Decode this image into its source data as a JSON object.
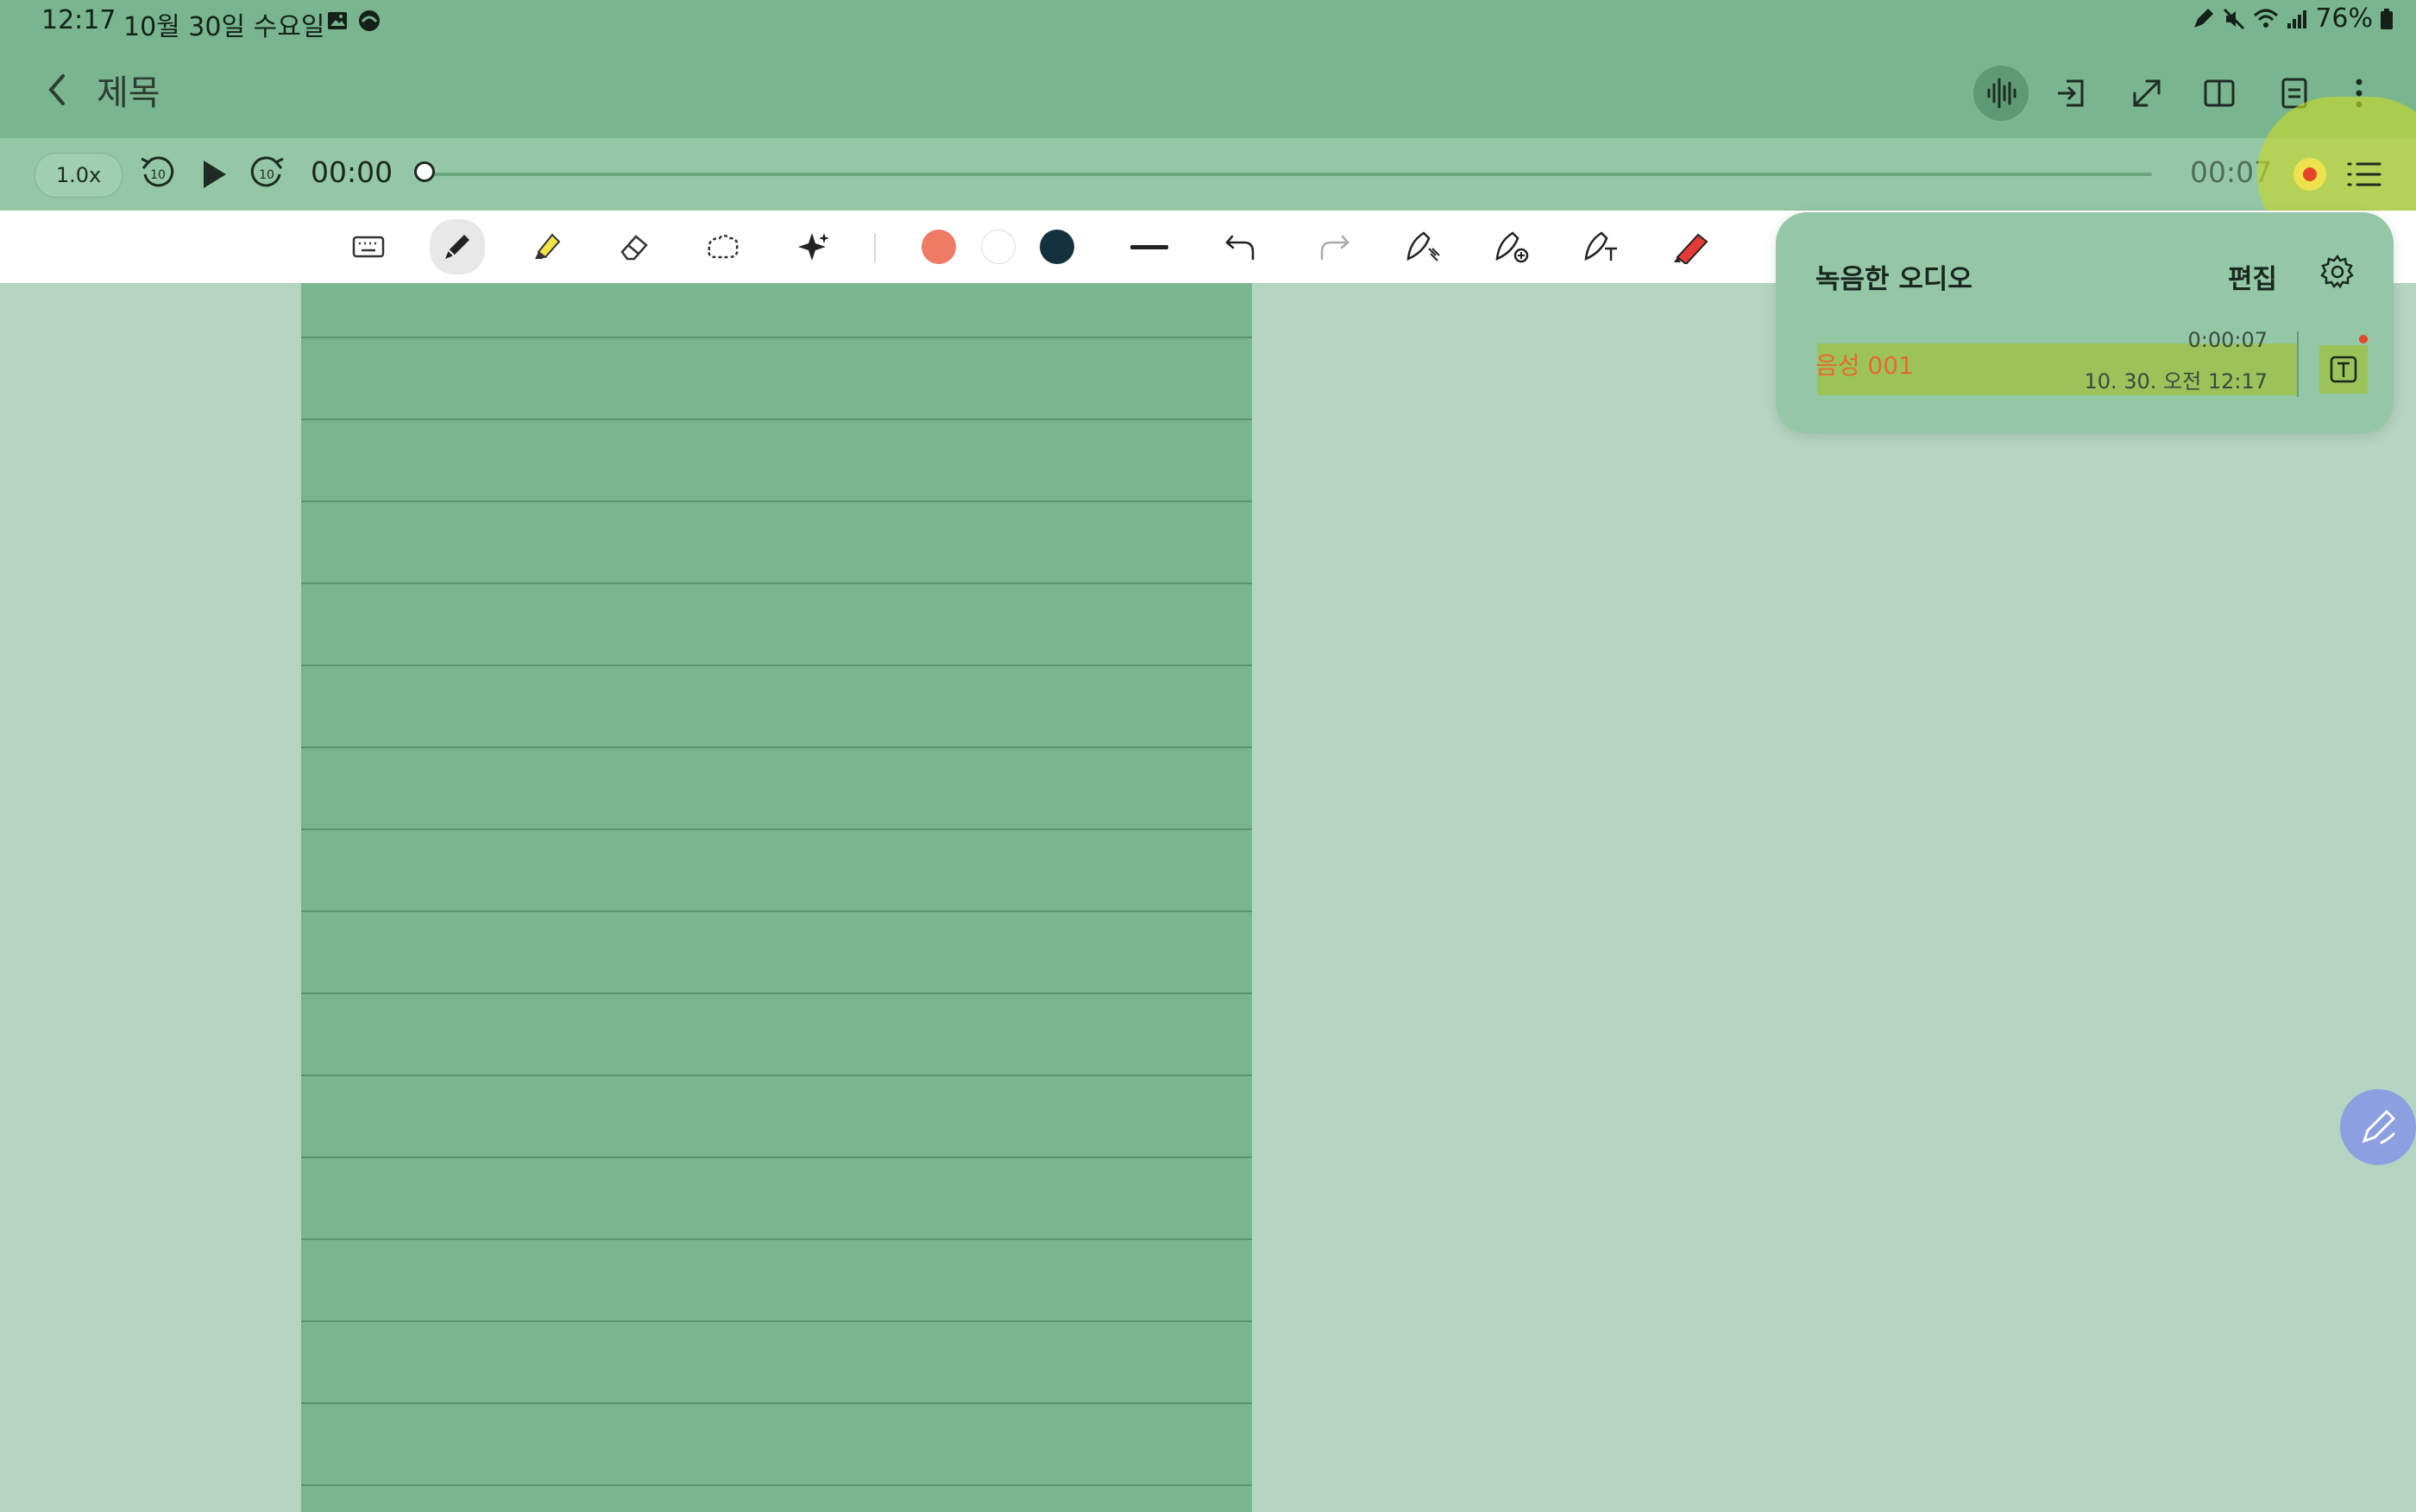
{
  "status_bar": {
    "time": "12:17",
    "date": "10월 30일 수요일",
    "battery": "76%"
  },
  "app_bar": {
    "title": "제목",
    "actions": [
      "voice-waveform-icon",
      "insert-icon",
      "expand-icon",
      "book-view-icon",
      "page-list-icon",
      "more-icon"
    ]
  },
  "playback": {
    "speed": "1.0x",
    "rewind_label": "10",
    "forward_label": "10",
    "elapsed": "00:00",
    "total": "00:07",
    "progress": 0.0
  },
  "toolbar": {
    "tools": [
      "keyboard-icon",
      "pen-icon",
      "highlighter-icon",
      "eraser-icon",
      "lasso-icon",
      "ai-assist-icon",
      "undo-icon",
      "redo-icon",
      "pen-style-icon",
      "pen-add-icon",
      "pen-text-icon",
      "pen-red-icon"
    ],
    "selected_tool": "pen-icon",
    "colors": [
      "#ef7b64",
      "#ffffff",
      "#14323d"
    ]
  },
  "recorded_audio": {
    "title": "녹음한 오디오",
    "edit_label": "편집",
    "items": [
      {
        "name": "음성 001",
        "duration": "0:00:07",
        "date": "10. 30. 오전 12:17"
      }
    ]
  },
  "colors": {
    "chrome_green": "#79b68f",
    "page_green": "#79b68f",
    "rule_line": "#5c9471",
    "record_red": "#e5452b",
    "fab_blue": "#8c9fe0"
  }
}
